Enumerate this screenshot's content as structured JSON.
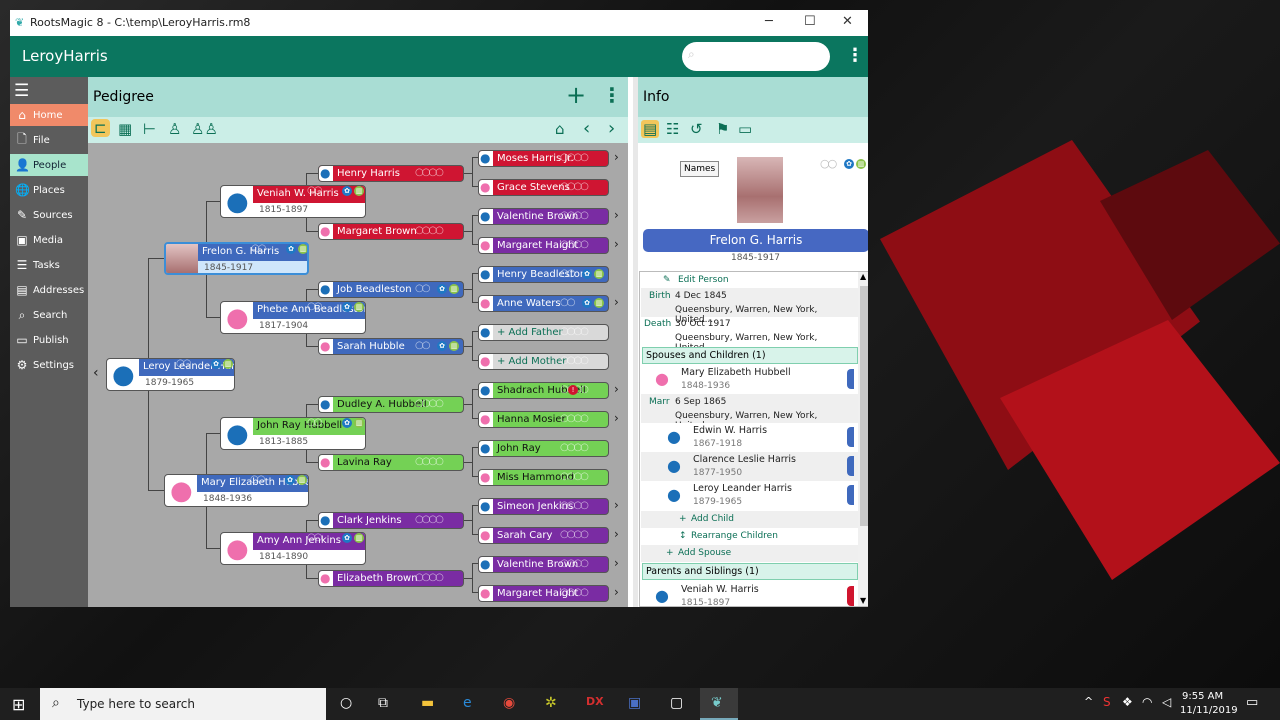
{
  "window": {
    "title": "RootsMagic 8 - C:\\temp\\LeroyHarris.rm8",
    "minimize": "─",
    "maximize": "☐",
    "close": "✕"
  },
  "app": {
    "title": "LeroyHarris",
    "search_placeholder": "",
    "menu_icon": "⋮"
  },
  "sidebar": {
    "items": [
      {
        "label": "Home",
        "icon": "⌂",
        "state": "active",
        "color": "#f08a6a"
      },
      {
        "label": "File",
        "icon": "🗋"
      },
      {
        "label": "People",
        "icon": "👤",
        "state": "selected",
        "color": "#a8e4cc"
      },
      {
        "label": "Places",
        "icon": "🌐"
      },
      {
        "label": "Sources",
        "icon": "✎"
      },
      {
        "label": "Media",
        "icon": "▣"
      },
      {
        "label": "Tasks",
        "icon": "☰"
      },
      {
        "label": "Addresses",
        "icon": "▤"
      },
      {
        "label": "Search",
        "icon": "⌕"
      },
      {
        "label": "Publish",
        "icon": "▭"
      },
      {
        "label": "Settings",
        "icon": "⚙"
      }
    ]
  },
  "pedigree": {
    "title": "Pedigree",
    "add": "+",
    "more": "⋮",
    "tools": [
      "pedigree-view",
      "family-view",
      "descendant-view",
      "individual-view",
      "people-view"
    ],
    "nav": {
      "home": "⌂",
      "back": "‹",
      "forward": "›"
    },
    "colors": {
      "red": "#cf1532",
      "purple": "#7a2ca3",
      "blue": "#3f69bd",
      "green": "#74d155",
      "add": "#d9d9d9",
      "male": "#1b6fb8",
      "female": "#ef6fad"
    },
    "people": [
      {
        "name": "Leroy Leander Harris",
        "years": "1879-1965",
        "color": "blue",
        "sex": "m",
        "badges": true
      },
      {
        "name": "Frelon G. Harris",
        "years": "1845-1917",
        "color": "blue",
        "sex": "photo",
        "badges": true,
        "selected": true
      },
      {
        "name": "Mary Elizabeth Hubbell",
        "years": "1848-1936",
        "color": "blue",
        "sex": "f",
        "badges": true
      },
      {
        "name": "Veniah W. Harris",
        "years": "1815-1897",
        "color": "red",
        "sex": "m",
        "badges": true
      },
      {
        "name": "Phebe Ann Beadleston",
        "years": "1817-1904",
        "color": "blue",
        "sex": "f",
        "badges": true
      },
      {
        "name": "John Ray Hubbell",
        "years": "1813-1885",
        "color": "green",
        "sex": "m",
        "badges": true
      },
      {
        "name": "Amy Ann Jenkins",
        "years": "1814-1890",
        "color": "purple",
        "sex": "f",
        "badges": true
      },
      {
        "name": "Henry Harris",
        "color": "red",
        "sex": "m"
      },
      {
        "name": "Margaret Brown",
        "color": "red",
        "sex": "f"
      },
      {
        "name": "Job Beadleston",
        "color": "blue",
        "sex": "m",
        "badges": true
      },
      {
        "name": "Sarah Hubble",
        "color": "blue",
        "sex": "f",
        "badges": true
      },
      {
        "name": "Dudley A. Hubbell",
        "color": "green",
        "sex": "m"
      },
      {
        "name": "Lavina Ray",
        "color": "green",
        "sex": "f"
      },
      {
        "name": "Clark Jenkins",
        "color": "purple",
        "sex": "m"
      },
      {
        "name": "Elizabeth Brown",
        "color": "purple",
        "sex": "f"
      },
      {
        "name": "Moses Harris Jr.",
        "color": "red",
        "sex": "m",
        "more": true
      },
      {
        "name": "Grace Stevens",
        "color": "red",
        "sex": "f"
      },
      {
        "name": "Valentine Brown",
        "color": "purple",
        "sex": "m",
        "more": true
      },
      {
        "name": "Margaret Haight",
        "color": "purple",
        "sex": "f",
        "more": true
      },
      {
        "name": "Henry Beadleston",
        "color": "blue",
        "sex": "m",
        "badges": true
      },
      {
        "name": "Anne Waters",
        "color": "blue",
        "sex": "f",
        "badges": true,
        "more": true
      },
      {
        "name": "+ Add Father",
        "color": "add",
        "sex": "m"
      },
      {
        "name": "+ Add Mother",
        "color": "add",
        "sex": "f"
      },
      {
        "name": "Shadrach Hubbell",
        "color": "green",
        "sex": "m",
        "more": true,
        "warning": "!"
      },
      {
        "name": "Hanna Mosier",
        "color": "green",
        "sex": "f",
        "more": true
      },
      {
        "name": "John Ray",
        "color": "green",
        "sex": "m"
      },
      {
        "name": "Miss Hammond",
        "color": "green",
        "sex": "f"
      },
      {
        "name": "Simeon Jenkins",
        "color": "purple",
        "sex": "m",
        "more": true
      },
      {
        "name": "Sarah Cary",
        "color": "purple",
        "sex": "f",
        "more": true
      },
      {
        "name": "Valentine Brown",
        "color": "purple",
        "sex": "m",
        "more": true
      },
      {
        "name": "Margaret Haight",
        "color": "purple",
        "sex": "f",
        "more": true
      }
    ],
    "more_arrow": "›",
    "back_arrow": "‹"
  },
  "info": {
    "title": "Info",
    "tooltip": "Names",
    "name": "Frelon G. Harris",
    "years": "1845-1917",
    "edit": "Edit Person",
    "birth": {
      "label": "Birth",
      "date": "4 Dec 1845",
      "place": "Queensbury, Warren, New York, United..."
    },
    "death": {
      "label": "Death",
      "date": "30 Oct 1917",
      "place": "Queensbury, Warren, New York, United..."
    },
    "spouses_header": "Spouses and Children (1)",
    "spouse": {
      "name": "Mary Elizabeth Hubbell",
      "years": "1848-1936"
    },
    "marr": {
      "label": "Marr",
      "date": "6 Sep 1865",
      "place": "Queensbury, Warren, New York, United..."
    },
    "children": [
      {
        "name": "Edwin W. Harris",
        "years": "1867-1918"
      },
      {
        "name": "Clarence Leslie Harris",
        "years": "1877-1950"
      },
      {
        "name": "Leroy Leander Harris",
        "years": "1879-1965"
      }
    ],
    "add_child": "Add Child",
    "rearrange": "Rearrange Children",
    "add_spouse": "Add Spouse",
    "parents_header": "Parents and Siblings (1)",
    "parent": {
      "name": "Veniah W. Harris",
      "years": "1815-1897"
    }
  },
  "taskbar": {
    "search_placeholder": "Type here to search",
    "time": "9:55 AM",
    "date": "11/11/2019"
  }
}
